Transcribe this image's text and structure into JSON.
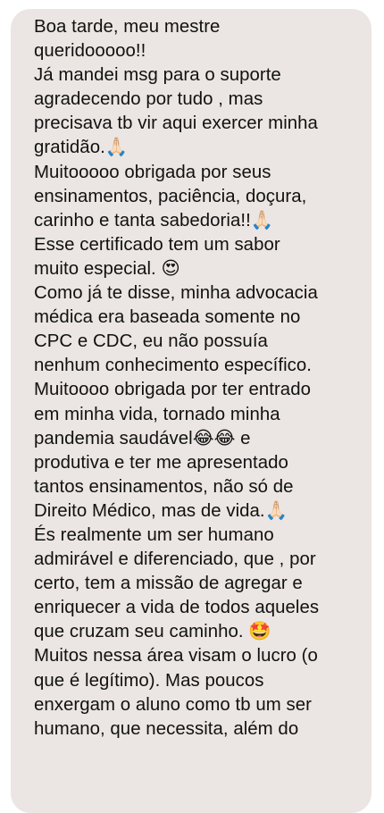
{
  "message": {
    "lines": [
      "Boa tarde, meu mestre",
      "queridooooo!!",
      "Já mandei msg para o suporte",
      "agradecendo por tudo , mas",
      "precisava tb vir aqui exercer minha",
      "gratidão.🙏🏻",
      "Muitooooo obrigada por seus",
      "ensinamentos, paciência, doçura,",
      "carinho e tanta sabedoria!!🙏🏻",
      "Esse certificado tem um sabor",
      "muito especial. 😍",
      "Como já te disse, minha advocacia",
      "médica era baseada somente no",
      "CPC e CDC, eu não possuía",
      "nenhum conhecimento específico.",
      "Muitoooo obrigada por ter entrado",
      "em minha vida, tornado minha",
      "pandemia saudável😂😂 e",
      "produtiva e ter me apresentado",
      "tantos ensinamentos, não só de",
      "Direito Médico, mas de vida.🙏🏻",
      "És realmente um ser humano",
      "admirável e diferenciado, que , por",
      "certo, tem a missão de agregar e",
      "enriquecer a vida de todos aqueles",
      "que cruzam seu caminho. 🤩",
      "Muitos nessa área visam o lucro (o",
      "que é legítimo). Mas poucos",
      "enxergam o aluno como tb um ser",
      "humano, que necessita, além do"
    ]
  },
  "colors": {
    "bubble": "#ebe6e3",
    "text": "#111111",
    "background": "#ffffff"
  }
}
